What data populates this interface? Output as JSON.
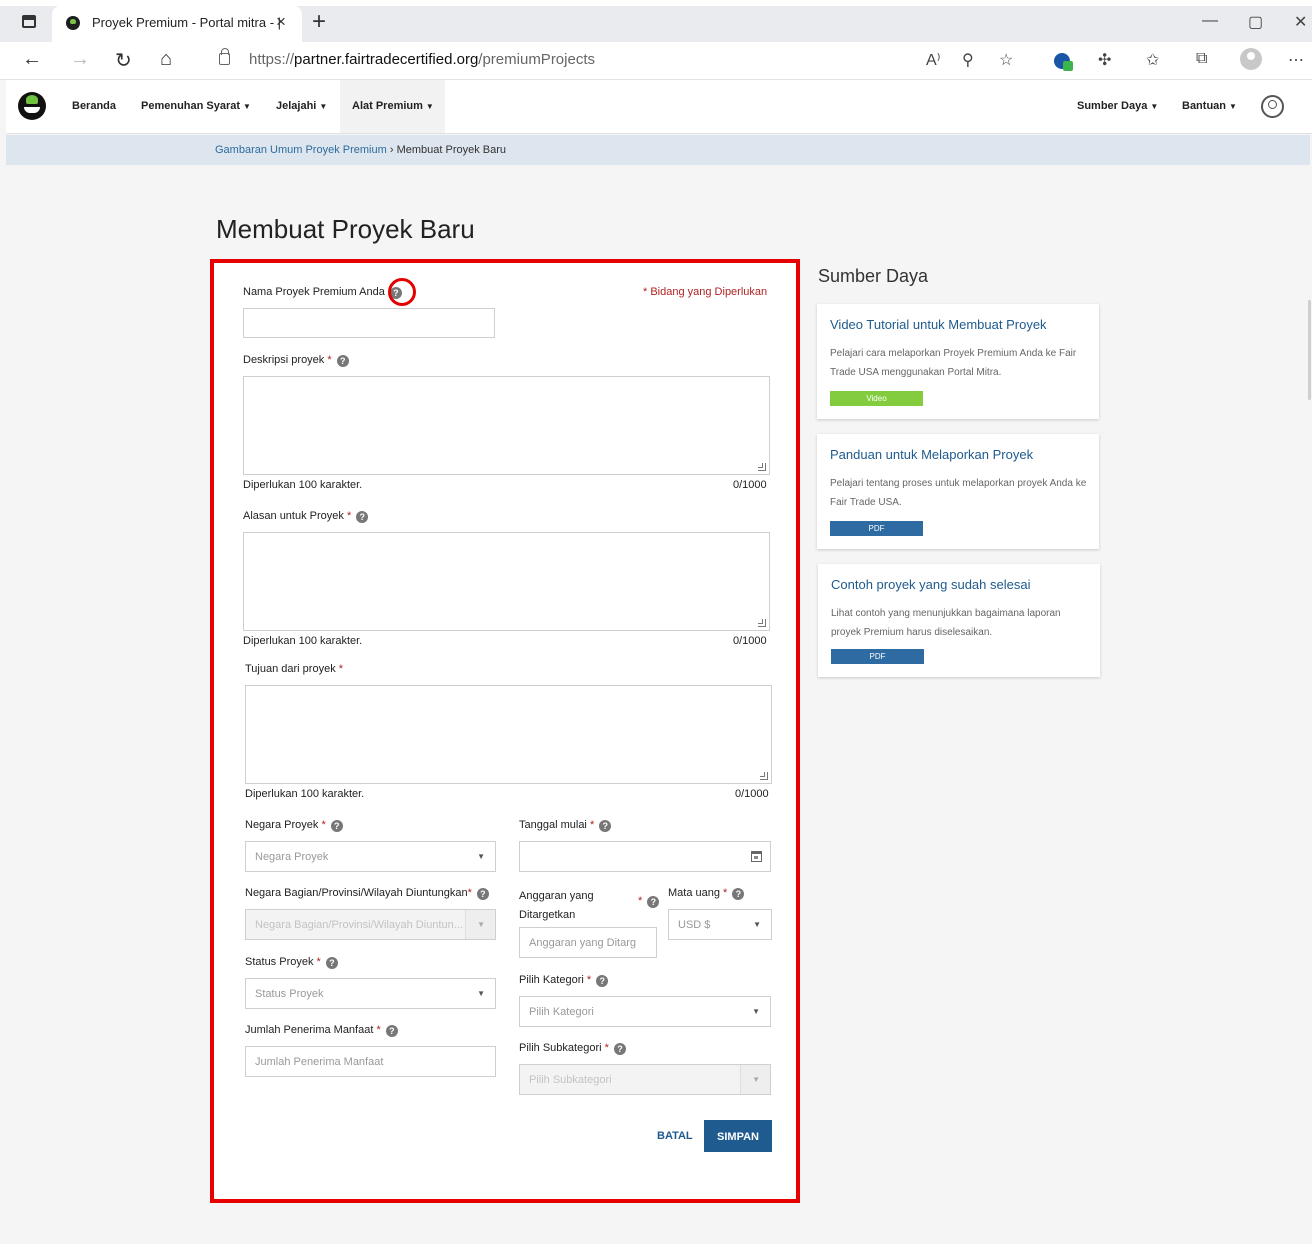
{
  "browser": {
    "tab_title": "Proyek Premium - Portal mitra - |",
    "tab_close": "×",
    "new_tab": "+",
    "url_prefix": "https://",
    "url_host": "partner.fairtradecertified.org",
    "url_path": "/premiumProjects"
  },
  "nav": {
    "items": [
      "Beranda",
      "Pemenuhan Syarat",
      "Jelajahi",
      "Alat Premium"
    ],
    "right_items": [
      "Sumber Daya",
      "Bantuan"
    ]
  },
  "breadcrumb": {
    "parent": "Gambaran Umum Proyek Premium",
    "separator": "›",
    "current": "Membuat Proyek Baru"
  },
  "page_title": "Membuat Proyek Baru",
  "form": {
    "required_note": "* Bidang yang Diperlukan",
    "project_name": {
      "label": "Nama Proyek Premium Anda",
      "value": ""
    },
    "description": {
      "label": "Deskripsi proyek",
      "hint": "Diperlukan 100 karakter.",
      "counter": "0/1000"
    },
    "reason": {
      "label": "Alasan untuk Proyek",
      "hint": "Diperlukan 100 karakter.",
      "counter": "0/1000"
    },
    "goal": {
      "label": "Tujuan dari proyek",
      "hint": "Diperlukan 100 karakter.",
      "counter": "0/1000"
    },
    "country": {
      "label": "Negara Proyek",
      "placeholder": "Negara Proyek"
    },
    "start_date": {
      "label": "Tanggal mulai",
      "value": ""
    },
    "region": {
      "label": "Negara Bagian/Provinsi/Wilayah Diuntungkan",
      "placeholder": "Negara Bagian/Provinsi/Wilayah Diuntun..."
    },
    "budget": {
      "label_line1": "Anggaran yang",
      "label_line2": "Ditargetkan",
      "placeholder": "Anggaran yang Ditarg"
    },
    "currency": {
      "label": "Mata uang",
      "value": "USD $"
    },
    "status": {
      "label": "Status Proyek",
      "placeholder": "Status Proyek"
    },
    "category": {
      "label": "Pilih Kategori",
      "placeholder": "Pilih Kategori"
    },
    "beneficiaries": {
      "label": "Jumlah Penerima Manfaat",
      "placeholder": "Jumlah Penerima Manfaat"
    },
    "subcategory": {
      "label": "Pilih Subkategori",
      "placeholder": "Pilih Subkategori"
    },
    "required_mark": "*",
    "help_glyph": "?",
    "cancel_label": "BATAL",
    "save_label": "SIMPAN"
  },
  "resources": {
    "heading": "Sumber Daya",
    "cards": [
      {
        "title": "Video Tutorial untuk Membuat Proyek",
        "desc": "Pelajari cara melaporkan Proyek Premium Anda ke Fair Trade USA menggunakan Portal Mitra.",
        "tag": "Video"
      },
      {
        "title": "Panduan untuk Melaporkan Proyek",
        "desc": "Pelajari tentang proses untuk melaporkan proyek Anda ke Fair Trade USA.",
        "tag": "PDF"
      },
      {
        "title": "Contoh proyek yang sudah selesai",
        "desc": "Lihat contoh yang menunjukkan bagaimana laporan proyek Premium harus diselesaikan.",
        "tag": "PDF"
      }
    ]
  },
  "colors": {
    "accent": "#1f5b8e",
    "highlight": "#e60000",
    "video_tag": "#82cc3d",
    "pdf_tag": "#2f6ba3"
  }
}
